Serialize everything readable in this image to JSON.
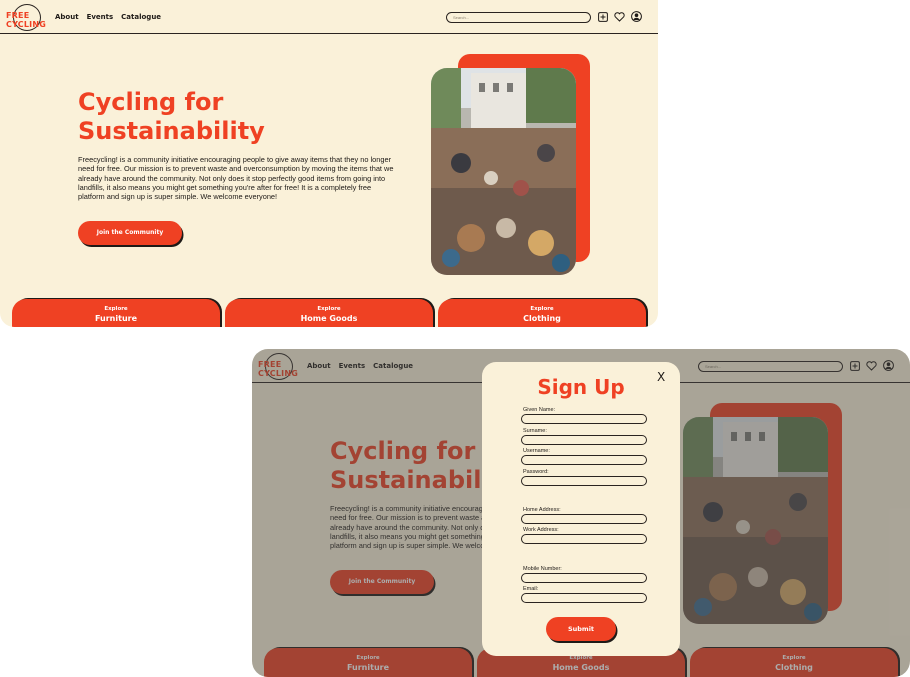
{
  "logo": {
    "line1": "FREE",
    "line2": "CYCLING"
  },
  "nav": {
    "links": [
      "About",
      "Events",
      "Catalogue"
    ]
  },
  "search": {
    "placeholder": "Search..."
  },
  "icons": [
    "add-icon",
    "heart-icon",
    "account-icon",
    "close-icon"
  ],
  "hero": {
    "title_line1": "Cycling for",
    "title_line2": "Sustainability",
    "description": "Freecycling! is a community initiative encouraging people to give away items that they no longer need for free. Our mission is to prevent waste and overconsumption by moving the items that we already have around the community. Not only does it stop perfectly good items from going into landfills, it also means you might get something you're after for free! It is a completely free platform and sign up is super simple. We welcome everyone!",
    "cta_label": "Join the Community"
  },
  "categories": [
    {
      "top": "Explore",
      "name": "Furniture"
    },
    {
      "top": "Explore",
      "name": "Home Goods"
    },
    {
      "top": "Explore",
      "name": "Clothing"
    }
  ],
  "modal": {
    "title": "Sign Up",
    "close_label": "X",
    "fields": [
      {
        "label": "Given Name:",
        "value": ""
      },
      {
        "label": "Surname:",
        "value": ""
      },
      {
        "label": "Username:",
        "value": ""
      },
      {
        "label": "Password:",
        "value": ""
      },
      {
        "label": "Home Address:",
        "value": ""
      },
      {
        "label": "Work Address:",
        "value": ""
      },
      {
        "label": "Mobile Number:",
        "value": ""
      },
      {
        "label": "Email:",
        "value": ""
      }
    ],
    "submit_label": "Submit"
  },
  "colors": {
    "accent": "#ef4123",
    "background": "#faf1d9",
    "text": "#1e1a17",
    "overlay": "#484848"
  }
}
